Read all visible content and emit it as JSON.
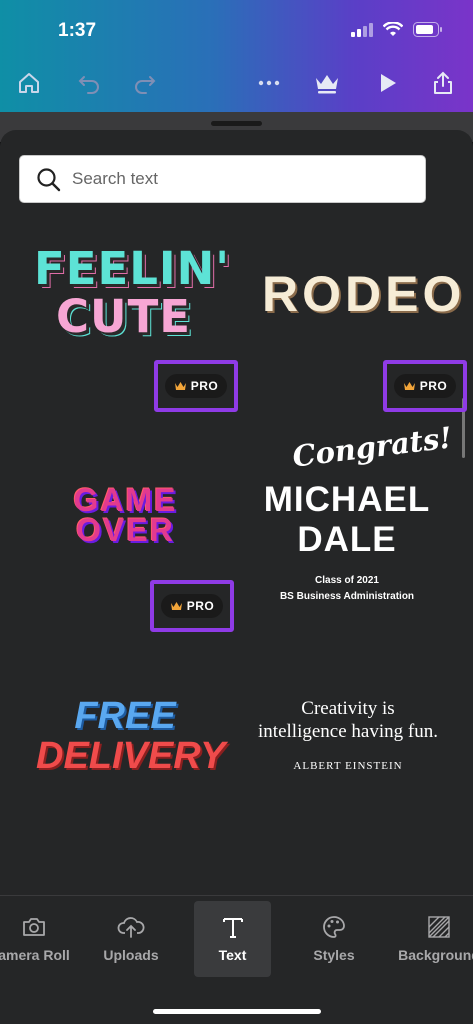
{
  "status_bar": {
    "time": "1:37"
  },
  "toolbar": {
    "icons": [
      "home-icon",
      "undo-icon",
      "redo-icon",
      "more-icon",
      "crown-icon",
      "play-icon",
      "share-icon"
    ]
  },
  "search": {
    "placeholder": "Search text",
    "value": ""
  },
  "pro_badge_label": "PRO",
  "templates": {
    "feelin_cute": {
      "line1": "FEELIN'",
      "line2": "CUTE",
      "pro": true
    },
    "rodeo": {
      "text": "RODEO",
      "pro": true
    },
    "game_over": {
      "line1": "GAME",
      "line2": "OVER",
      "pro": true
    },
    "graduation": {
      "script": "Congrats!",
      "line1": "MICHAEL",
      "line2": "DALE",
      "sub1": "Class of 2021",
      "sub2": "BS Business Administration"
    },
    "free_delivery": {
      "line1": "FREE",
      "line2": "DELIVERY"
    },
    "quote": {
      "text": "Creativity is intelligence having fun.",
      "author": "ALBERT EINSTEIN"
    }
  },
  "tabs": [
    {
      "label": "amera Roll",
      "icon": "camera-icon",
      "active": false
    },
    {
      "label": "Uploads",
      "icon": "upload-cloud-icon",
      "active": false
    },
    {
      "label": "Text",
      "icon": "text-t-icon",
      "active": true
    },
    {
      "label": "Styles",
      "icon": "palette-icon",
      "active": false
    },
    {
      "label": "Background",
      "icon": "background-hatch-icon",
      "active": false
    }
  ],
  "colors": {
    "pro_highlight": "#8f3be6",
    "sheet_bg": "#252627"
  }
}
